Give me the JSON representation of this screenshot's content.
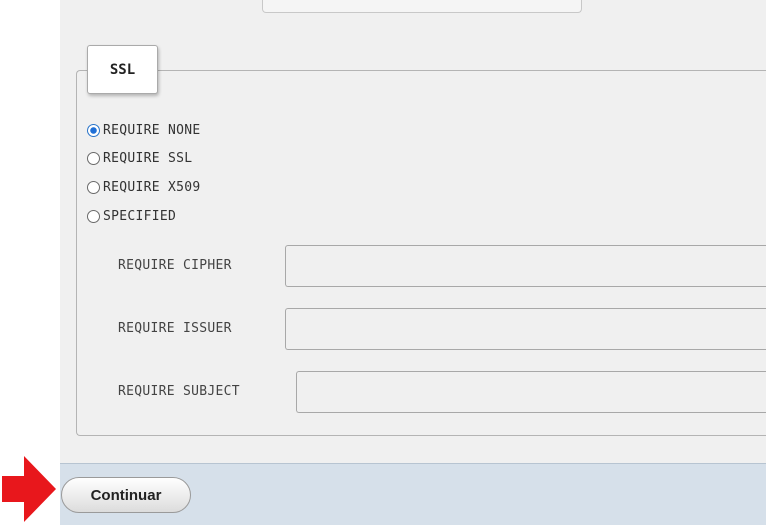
{
  "ssl": {
    "legend": "SSL",
    "options": [
      {
        "label": "REQUIRE NONE",
        "checked": true
      },
      {
        "label": "REQUIRE SSL",
        "checked": false
      },
      {
        "label": "REQUIRE X509",
        "checked": false
      },
      {
        "label": "SPECIFIED",
        "checked": false
      }
    ],
    "fields": {
      "cipher": {
        "label": "REQUIRE CIPHER",
        "value": ""
      },
      "issuer": {
        "label": "REQUIRE ISSUER",
        "value": ""
      },
      "subject": {
        "label": "REQUIRE SUBJECT",
        "value": ""
      }
    }
  },
  "footer": {
    "continue_label": "Continuar"
  },
  "colors": {
    "arrow": "#e8171c",
    "panel_bg": "#f0f0f0",
    "footer_bg": "#d6e0ea",
    "radio_checked": "#1f6fd6"
  },
  "icons": {
    "pointer": "red-arrow-icon"
  }
}
